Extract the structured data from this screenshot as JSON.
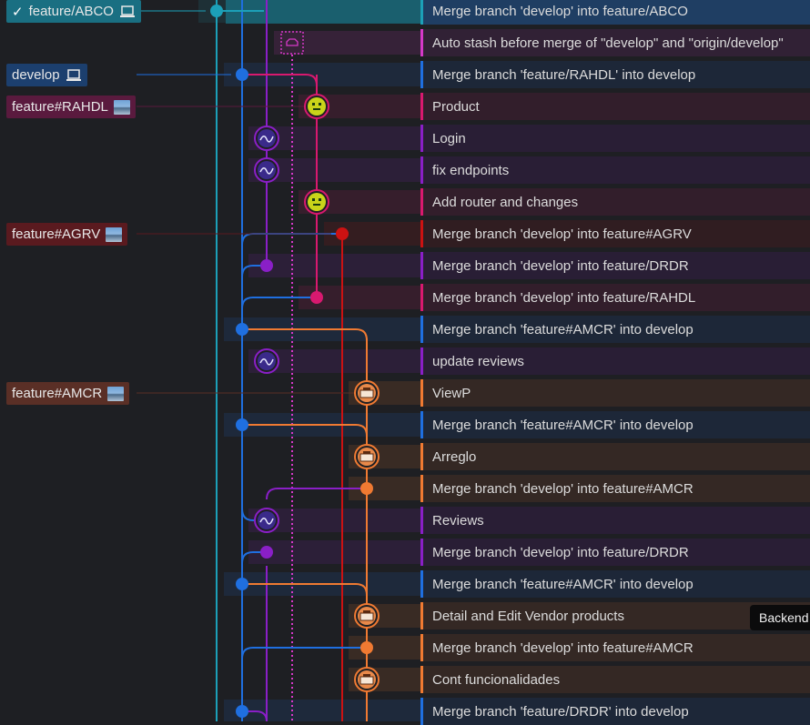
{
  "colors": {
    "background": "#1e1f23",
    "lane_teal": "#1ca0b8",
    "lane_blue": "#1f6fe0",
    "lane_purple": "#8a1fc7",
    "lane_magenta": "#d8196f",
    "lane_red": "#cc1212",
    "lane_orange": "#f07a32",
    "lane_pink_dotted": "#d639c8"
  },
  "branches": [
    {
      "label": "feature/ABCO",
      "checked": true,
      "icon": "laptop-icon",
      "color": "#1a6f82"
    },
    {
      "label": "develop",
      "checked": false,
      "icon": "laptop-icon",
      "color": "#1c3f6e"
    },
    {
      "label": "feature#RAHDL",
      "checked": false,
      "icon": "avatar-image",
      "color": "#5a1a3e"
    },
    {
      "label": "feature#AGRV",
      "checked": false,
      "icon": "avatar-image",
      "color": "#5a1a1f"
    },
    {
      "label": "feature#AMCR",
      "checked": false,
      "icon": "avatar-image",
      "color": "#5a2f26"
    }
  ],
  "commits": [
    {
      "message": "Merge branch 'develop' into feature/ABCO",
      "lane": "teal"
    },
    {
      "message": "Auto stash before merge of \"develop\" and \"origin/develop\"",
      "lane": "pink"
    },
    {
      "message": "Merge branch 'feature/RAHDL' into develop",
      "lane": "blue"
    },
    {
      "message": "Product",
      "lane": "magenta"
    },
    {
      "message": "Login",
      "lane": "purple"
    },
    {
      "message": "fix endpoints",
      "lane": "purple"
    },
    {
      "message": "Add router and changes",
      "lane": "magenta"
    },
    {
      "message": "Merge branch 'develop' into feature#AGRV",
      "lane": "red"
    },
    {
      "message": "Merge branch 'develop' into feature/DRDR",
      "lane": "purple"
    },
    {
      "message": "Merge branch 'develop' into feature/RAHDL",
      "lane": "magenta"
    },
    {
      "message": "Merge branch 'feature#AMCR' into develop",
      "lane": "blue"
    },
    {
      "message": "update reviews",
      "lane": "purple"
    },
    {
      "message": "ViewP",
      "lane": "orange"
    },
    {
      "message": "Merge branch 'feature#AMCR' into develop",
      "lane": "blue"
    },
    {
      "message": "Arreglo",
      "lane": "orange"
    },
    {
      "message": "Merge branch 'develop' into feature#AMCR",
      "lane": "orange"
    },
    {
      "message": "Reviews",
      "lane": "purple"
    },
    {
      "message": "Merge branch 'develop' into feature/DRDR",
      "lane": "purple"
    },
    {
      "message": "Merge branch 'feature#AMCR' into develop",
      "lane": "blue"
    },
    {
      "message": "Detail and Edit Vendor products",
      "lane": "orange"
    },
    {
      "message": "Merge branch 'develop' into feature#AMCR",
      "lane": "orange"
    },
    {
      "message": "Cont funcionalidades",
      "lane": "orange"
    },
    {
      "message": "Merge branch 'feature/DRDR' into develop",
      "lane": "blue"
    }
  ],
  "tooltip": {
    "text": "Backend"
  }
}
